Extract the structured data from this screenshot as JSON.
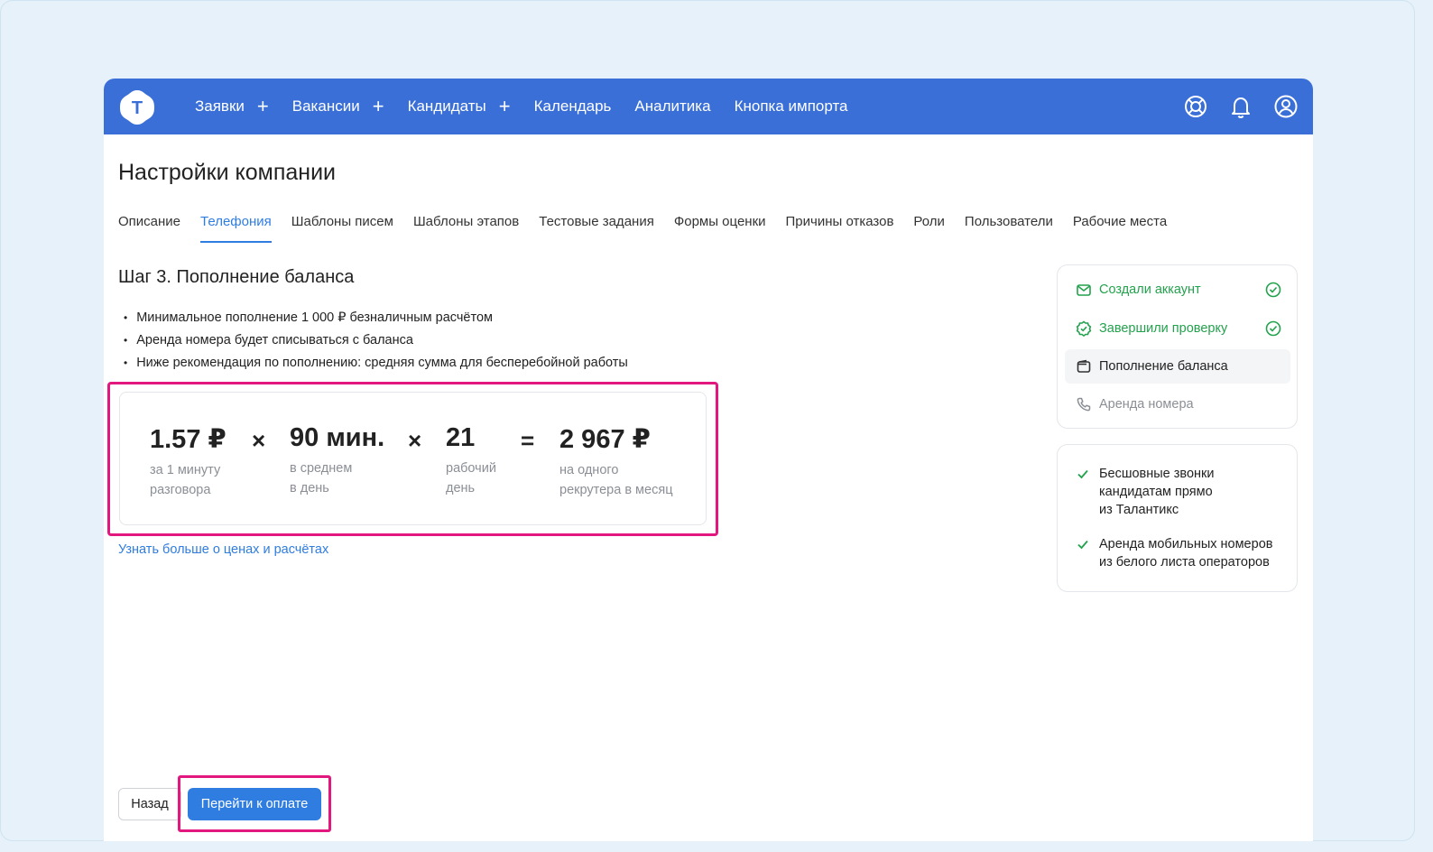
{
  "nav": {
    "items": [
      {
        "label": "Заявки",
        "has_plus": true
      },
      {
        "label": "Вакансии",
        "has_plus": true
      },
      {
        "label": "Кандидаты",
        "has_plus": true
      },
      {
        "label": "Календарь",
        "has_plus": false
      },
      {
        "label": "Аналитика",
        "has_plus": false
      },
      {
        "label": "Кнопка импорта",
        "has_plus": false
      }
    ],
    "plus_symbol": "+",
    "logo_letter": "T"
  },
  "page": {
    "title": "Настройки компании"
  },
  "tabs": [
    {
      "label": "Описание",
      "active": false
    },
    {
      "label": "Телефония",
      "active": true
    },
    {
      "label": "Шаблоны писем",
      "active": false
    },
    {
      "label": "Шаблоны этапов",
      "active": false
    },
    {
      "label": "Тестовые задания",
      "active": false
    },
    {
      "label": "Формы оценки",
      "active": false
    },
    {
      "label": "Причины отказов",
      "active": false
    },
    {
      "label": "Роли",
      "active": false
    },
    {
      "label": "Пользователи",
      "active": false
    },
    {
      "label": "Рабочие места",
      "active": false
    }
  ],
  "step": {
    "title": "Шаг 3. Пополнение баланса",
    "bullets": [
      "Минимальное пополнение 1 000 ₽ безналичным расчётом",
      "Аренда номера будет списываться с баланса",
      "Ниже рекомендация по пополнению: средняя сумма для бесперебойной работы"
    ]
  },
  "calc": {
    "items": [
      {
        "value": "1.57 ₽",
        "sub1": "за 1 минуту",
        "sub2": "разговора"
      },
      {
        "value": "90 мин.",
        "sub1": "в среднем",
        "sub2": "в день"
      },
      {
        "value": "21",
        "sub1": "рабочий",
        "sub2": "день"
      },
      {
        "value": "2 967 ₽",
        "sub1": "на одного",
        "sub2": "рекрутера в месяц"
      }
    ],
    "ops": [
      "×",
      "×",
      "="
    ]
  },
  "learn_more": "Узнать больше о ценах и расчётах",
  "buttons": {
    "back": "Назад",
    "pay": "Перейти к оплате"
  },
  "progress": {
    "steps": [
      {
        "label": "Создали аккаунт",
        "state": "done"
      },
      {
        "label": "Завершили проверку",
        "state": "done"
      },
      {
        "label": "Пополнение баланса",
        "state": "current"
      },
      {
        "label": "Аренда номера",
        "state": "pending"
      }
    ]
  },
  "features": [
    {
      "lines": [
        "Бесшовные звонки",
        "кандидатам прямо",
        "из Талантикс"
      ]
    },
    {
      "lines": [
        "Аренда мобильных номеров",
        "из белого листа операторов"
      ]
    }
  ],
  "colors": {
    "brand": "#3a6fd8",
    "accent": "#2f7de1",
    "success": "#23a24d",
    "highlight": "#e2187f"
  }
}
